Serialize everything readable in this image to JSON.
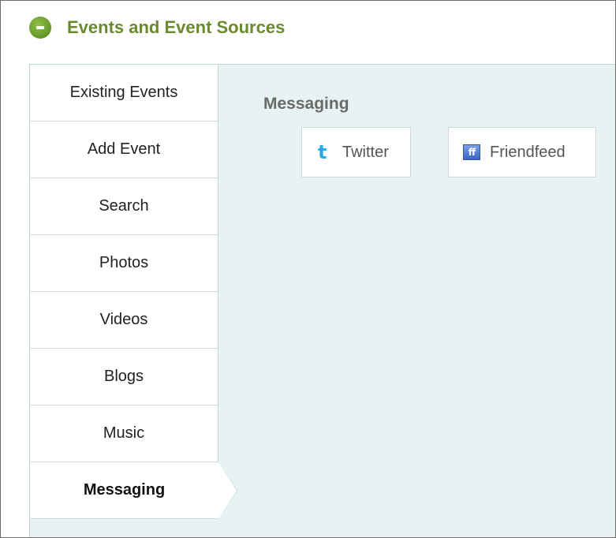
{
  "header": {
    "collapse_icon": "minus-circle-icon",
    "title": "Events and Event Sources"
  },
  "tabs": [
    {
      "label": "Existing Events",
      "active": false
    },
    {
      "label": "Add Event",
      "active": false
    },
    {
      "label": "Search",
      "active": false
    },
    {
      "label": "Photos",
      "active": false
    },
    {
      "label": "Videos",
      "active": false
    },
    {
      "label": "Blogs",
      "active": false
    },
    {
      "label": "Music",
      "active": false
    },
    {
      "label": "Messaging",
      "active": true
    }
  ],
  "content": {
    "section_title": "Messaging",
    "sources": [
      {
        "label": "Twitter",
        "icon": "twitter-icon",
        "glyph": "t"
      },
      {
        "label": "Friendfeed",
        "icon": "friendfeed-icon",
        "glyph": "ff"
      }
    ]
  },
  "colors": {
    "title_green": "#6a8a2e",
    "panel_bg": "#e7f3f2",
    "button_green": "#6b9b2a"
  }
}
